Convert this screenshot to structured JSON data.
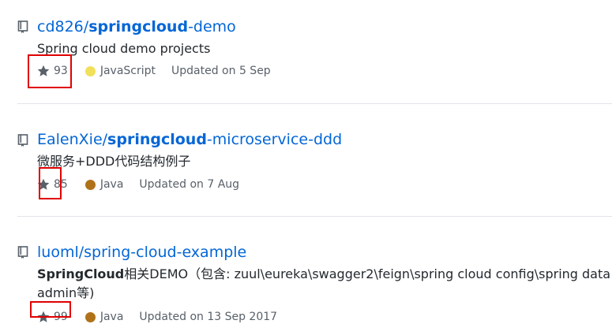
{
  "repos": [
    {
      "owner": "cd826/",
      "name_highlight": "springcloud",
      "name_rest": "-demo",
      "description_plain": "Spring cloud demo projects",
      "stars": "93",
      "language": "JavaScript",
      "language_color": "#f1e05a",
      "updated": "Updated on 5 Sep"
    },
    {
      "owner": "EalenXie/",
      "name_highlight": "springcloud",
      "name_rest": "-microservice-ddd",
      "description_plain": "微服务+DDD代码结构例子",
      "stars": "85",
      "language": "Java",
      "language_color": "#b07219",
      "updated": "Updated on 7 Aug"
    },
    {
      "owner": "luoml/spring-cloud-example",
      "description_highlight": "SpringCloud",
      "description_rest": "相关DEMO（包含: zuul\\eureka\\swagger2\\feign\\spring cloud config\\spring data re",
      "description_line2": "admin等)",
      "stars": "99",
      "language": "Java",
      "language_color": "#b07219",
      "updated": "Updated on 13 Sep 2017"
    }
  ],
  "colors": {
    "link": "#0366d6",
    "muted": "#586069",
    "annotation": "#e00000"
  },
  "icons": {
    "repo": "repo-icon",
    "star": "star-icon"
  }
}
